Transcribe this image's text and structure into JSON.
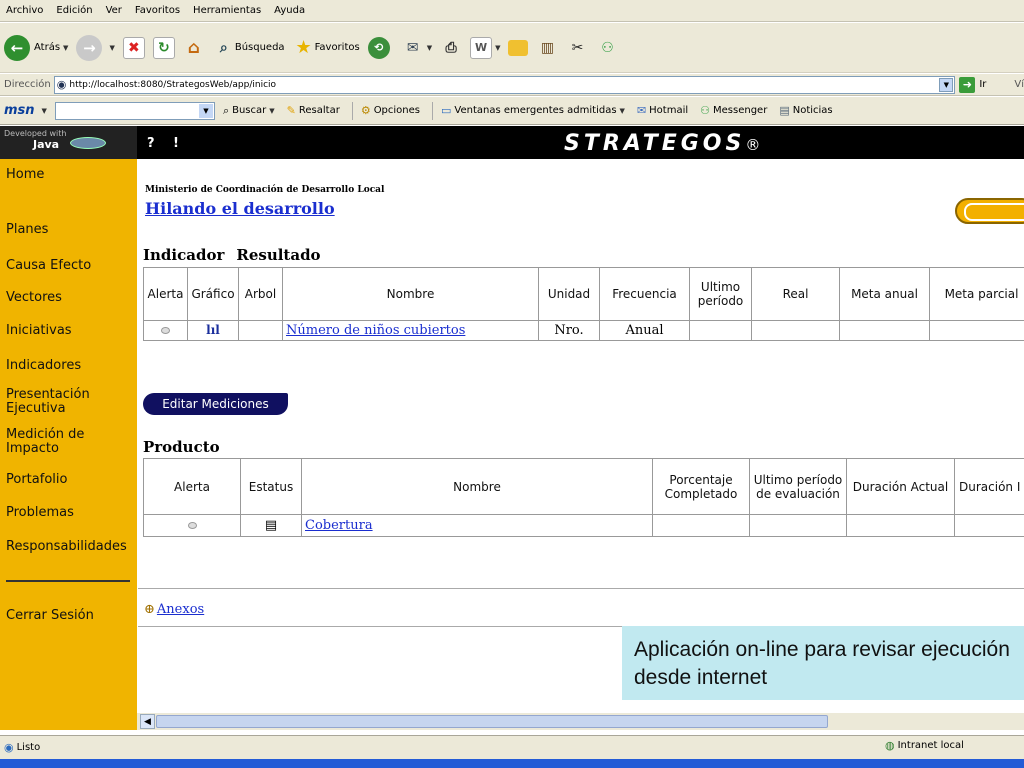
{
  "menu": [
    "Archivo",
    "Edición",
    "Ver",
    "Favoritos",
    "Herramientas",
    "Ayuda"
  ],
  "toolbar": {
    "back": "Atrás",
    "search": "Búsqueda",
    "favorites": "Favoritos"
  },
  "address": {
    "label": "Dirección",
    "url": "http://localhost:8080/StrategosWeb/app/inicio",
    "go": "Ir",
    "links": "Ví"
  },
  "msn": {
    "logo": "msn",
    "search": "Buscar",
    "highlight": "Resaltar",
    "options": "Opciones",
    "popups": "Ventanas emergentes admitidas",
    "hotmail": "Hotmail",
    "messenger": "Messenger",
    "news": "Noticias"
  },
  "sidebar": {
    "developed": "Developed with",
    "java": "Java",
    "items": [
      "Home",
      "Planes",
      "Causa Efecto",
      "Vectores",
      "Iniciativas",
      "Indicadores",
      "Presentación Ejecutiva",
      "Medición de Impacto",
      "Portafolio",
      "Problemas",
      "Responsabilidades"
    ],
    "logout": "Cerrar Sesión"
  },
  "header": {
    "help": "?",
    "info": "!",
    "brand": "STRATEGOS",
    "reg": "®"
  },
  "page": {
    "org": "Ministerio de Coordinación de Desarrollo Local",
    "subtitle": "Hilando el desarrollo"
  },
  "indicador": {
    "title1": "Indicador",
    "title2": "Resultado",
    "columns": [
      "Alerta",
      "Gráfico",
      "Arbol",
      "Nombre",
      "Unidad",
      "Frecuencia",
      "Ultimo período",
      "Real",
      "Meta anual",
      "Meta parcial"
    ],
    "rows": [
      {
        "nombre": "Número de niños cubiertos",
        "unidad": "Nro.",
        "frecuencia": "Anual"
      }
    ]
  },
  "edit_button": "Editar Mediciones",
  "producto": {
    "title": "Producto",
    "columns": [
      "Alerta",
      "Estatus",
      "Nombre",
      "Porcentaje Completado",
      "Ultimo período de evaluación",
      "Duración Actual",
      "Duración I"
    ],
    "rows": [
      {
        "nombre": "Cobertura"
      }
    ]
  },
  "anexos": "Anexos",
  "callout": "Aplicación on-line para revisar ejecución desde internet",
  "status": {
    "left": "Listo",
    "zone": "Intranet local"
  }
}
